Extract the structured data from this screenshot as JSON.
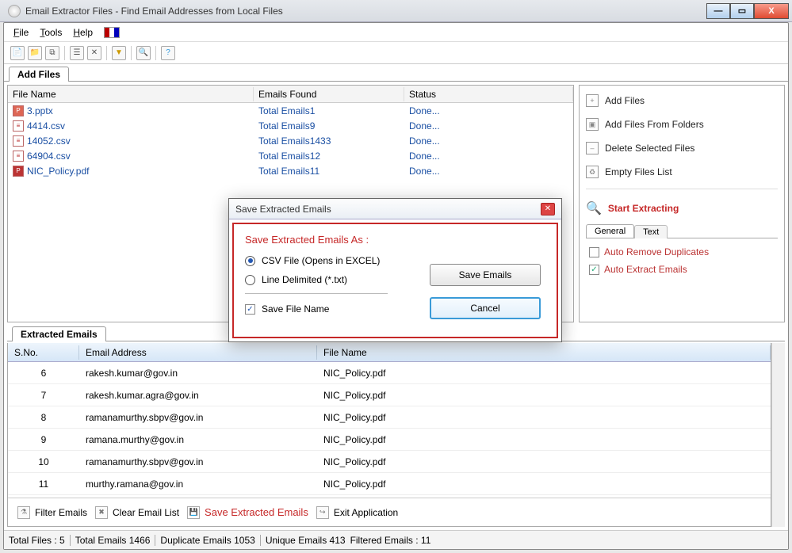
{
  "window": {
    "title": "Email Extractor Files -   Find Email Addresses from Local Files"
  },
  "menu": {
    "file": "File",
    "tools": "Tools",
    "help": "Help"
  },
  "tabs": {
    "addfiles": "Add Files",
    "extracted": "Extracted Emails"
  },
  "filecols": {
    "fn": "File Name",
    "ef": "Emails Found",
    "st": "Status"
  },
  "files": [
    {
      "name": "3.pptx",
      "ico": "ppt",
      "emails": "Total Emails1",
      "status": "Done..."
    },
    {
      "name": "4414.csv",
      "ico": "csv",
      "emails": "Total Emails9",
      "status": "Done..."
    },
    {
      "name": "14052.csv",
      "ico": "csv",
      "emails": "Total Emails1433",
      "status": "Done..."
    },
    {
      "name": "64904.csv",
      "ico": "csv",
      "emails": "Total Emails12",
      "status": "Done..."
    },
    {
      "name": "NIC_Policy.pdf",
      "ico": "pdf",
      "emails": "Total Emails11",
      "status": "Done..."
    }
  ],
  "actions": {
    "add": "Add Files",
    "addfolder": "Add Files From Folders",
    "delete": "Delete Selected Files",
    "empty": "Empty Files List",
    "start": "Start Extracting"
  },
  "subtabs": {
    "general": "General",
    "text": "Text"
  },
  "options": {
    "dup": "Auto Remove Duplicates",
    "ext": "Auto Extract Emails"
  },
  "ecols": {
    "sn": "S.No.",
    "em": "Email Address",
    "fn": "File Name"
  },
  "emails": [
    {
      "sn": "6",
      "em": "rakesh.kumar@gov.in",
      "fn": "NIC_Policy.pdf"
    },
    {
      "sn": "7",
      "em": "rakesh.kumar.agra@gov.in",
      "fn": "NIC_Policy.pdf"
    },
    {
      "sn": "8",
      "em": "ramanamurthy.sbpv@gov.in",
      "fn": "NIC_Policy.pdf"
    },
    {
      "sn": "9",
      "em": "ramana.murthy@gov.in",
      "fn": "NIC_Policy.pdf"
    },
    {
      "sn": "10",
      "em": "ramanamurthy.sbpv@gov.in",
      "fn": "NIC_Policy.pdf"
    },
    {
      "sn": "11",
      "em": "murthy.ramana@gov.in",
      "fn": "NIC_Policy.pdf"
    }
  ],
  "bottom": {
    "filter": "Filter Emails",
    "clear": "Clear Email List",
    "save": "Save Extracted Emails",
    "exit": "Exit Application"
  },
  "status": {
    "tf": "Total Files :  5",
    "te": "Total Emails  1466",
    "de": "Duplicate Emails  1053",
    "ue": "Unique Emails  413",
    "fe": "Filtered Emails :  11"
  },
  "dialog": {
    "title": "Save Extracted Emails",
    "heading": "Save Extracted Emails As :",
    "csv": "CSV File (Opens in EXCEL)",
    "txt": "Line Delimited (*.txt)",
    "savefn": "Save File Name",
    "save": "Save Emails",
    "cancel": "Cancel"
  }
}
